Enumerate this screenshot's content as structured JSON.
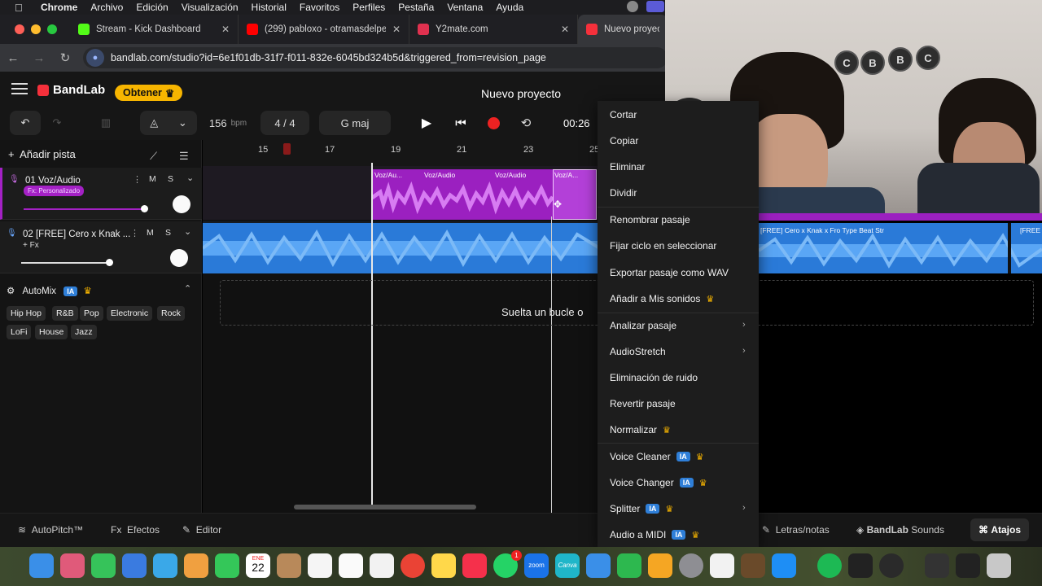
{
  "menubar": {
    "app": "Chrome",
    "items": [
      "Archivo",
      "Edición",
      "Visualización",
      "Historial",
      "Favoritos",
      "Perfiles",
      "Pestaña",
      "Ventana",
      "Ayuda"
    ]
  },
  "browser": {
    "tabs": [
      {
        "title": "Stream - Kick Dashboard",
        "color": "#53fc18",
        "icon": "kick-icon"
      },
      {
        "title": "(299) pabloxo - otramasdelpe",
        "color": "#ff0000",
        "icon": "youtube-icon"
      },
      {
        "title": "Y2mate.com",
        "color": "#e0314f",
        "icon": "y2mate-icon"
      },
      {
        "title": "Nuevo proyecto",
        "color": "#f5303b",
        "icon": "bandlab-icon"
      }
    ],
    "url": "bandlab.com/studio?id=6e1f01db-31f7-f011-832e-6045bd324b5d&triggered_from=revision_page"
  },
  "header": {
    "logo": "BandLab",
    "obtener": "Obtener",
    "project_title": "Nuevo proyecto"
  },
  "toolbar": {
    "bpm_value": "156",
    "bpm_unit": "bpm",
    "time_sig": "4 / 4",
    "key": "G maj",
    "time": "00:26"
  },
  "tracks": {
    "add_label": "Añadir pista",
    "track1": {
      "name": "01  Voz/Audio",
      "pill": "Fx: Personalizado",
      "mute": "M",
      "solo": "S"
    },
    "track2": {
      "name": "02  [FREE] Cero x Knak ...",
      "fx": "+ Fx",
      "mute": "M",
      "solo": "S"
    }
  },
  "automix": {
    "label": "AutoMix",
    "ia": "IA",
    "genres": [
      "Hip Hop",
      "R&B",
      "Pop",
      "Electronic",
      "Rock",
      "LoFi",
      "House",
      "Jazz"
    ]
  },
  "ruler": {
    "marks": [
      "15",
      "17",
      "19",
      "21",
      "23",
      "25"
    ]
  },
  "clips": {
    "voz1": "Voz/Au...",
    "voz2": "Voz/Audio",
    "voz3": "Voz/Audio",
    "voz4": "Voz/A...",
    "beat2": "[FREE] Cero x Knak x Fro  Type Beat  Str",
    "beat3": "[FREE"
  },
  "drop_text": "Suelta un bucle o",
  "bottombar": {
    "autopitch": "AutoPitch™",
    "efectos": "Efectos",
    "editor": "Editor",
    "letras": "Letras/notas",
    "sounds_brand": "BandLab",
    "sounds": "Sounds",
    "atajos": "Atajos"
  },
  "context_menu": {
    "cortar": "Cortar",
    "copiar": "Copiar",
    "eliminar": "Eliminar",
    "dividir": "Dividir",
    "renombrar": "Renombrar pasaje",
    "fijar": "Fijar ciclo en seleccionar",
    "exportar": "Exportar pasaje como WAV",
    "anadir": "Añadir a Mis sonidos",
    "analizar": "Analizar pasaje",
    "audiostretch": "AudioStretch",
    "ruido": "Eliminación de ruido",
    "revertir": "Revertir pasaje",
    "normalizar": "Normalizar",
    "voice_cleaner": "Voice Cleaner",
    "voice_changer": "Voice Changer",
    "splitter": "Splitter",
    "audio_midi": "Audio a MIDI",
    "ia": "IA"
  },
  "webcam": {
    "shelf_letters": [
      "C",
      "B",
      "B",
      "C"
    ]
  },
  "dock": {
    "calendar_month": "ENE",
    "calendar_day": "22",
    "zoom": "zoom",
    "canva": "Canva",
    "badge": "1"
  },
  "colors": {
    "purple": "#a421c5",
    "blue": "#3a8fe8",
    "gold": "#f7b500",
    "red": "#f5303b"
  }
}
